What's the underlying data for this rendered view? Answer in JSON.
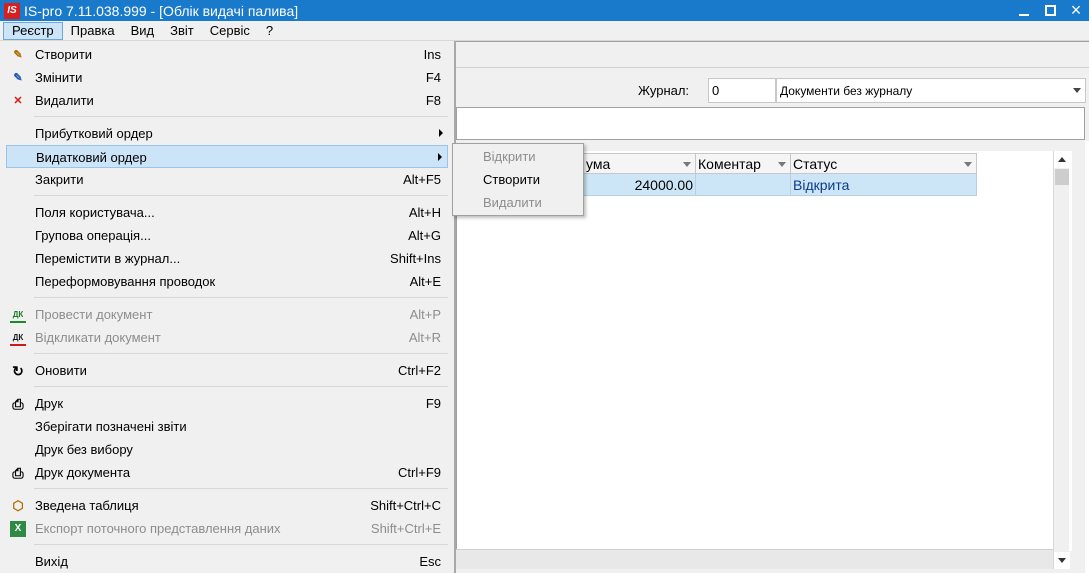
{
  "window": {
    "logo": "IS",
    "title": "IS-pro 7.11.038.999 - [Облік видачі палива]",
    "minimize": "_",
    "close": "×"
  },
  "menubar": [
    "Реєстр",
    "Правка",
    "Вид",
    "Звіт",
    "Сервіс",
    "?"
  ],
  "journal": {
    "label": "Журнал:",
    "number": "0",
    "selected": "Документи без журналу"
  },
  "grid": {
    "headers": [
      "ума",
      "Коментар",
      "Статус"
    ],
    "rows": [
      {
        "sum": "24000.00",
        "comment": "",
        "status": "Відкрита"
      }
    ]
  },
  "dropdown": {
    "items": [
      {
        "label": "Створити",
        "shortcut": "Ins",
        "icon": "new-doc-icon",
        "glyph": "✎"
      },
      {
        "label": "Змінити",
        "shortcut": "F4",
        "icon": "edit-doc-icon",
        "glyph": "✎"
      },
      {
        "label": "Видалити",
        "shortcut": "F8",
        "icon": "delete-doc-icon",
        "glyph": "✕"
      },
      {
        "label": "Прибутковий ордер",
        "shortcut": "",
        "icon": "",
        "glyph": ""
      },
      {
        "label": "Видатковий ордер",
        "shortcut": "",
        "icon": "",
        "glyph": ""
      },
      {
        "label": "Закрити",
        "shortcut": "Alt+F5",
        "icon": "",
        "glyph": ""
      },
      {
        "label": "Поля користувача...",
        "shortcut": "Alt+H",
        "icon": "",
        "glyph": ""
      },
      {
        "label": "Групова операція...",
        "shortcut": "Alt+G",
        "icon": "",
        "glyph": ""
      },
      {
        "label": "Перемістити в журнал...",
        "shortcut": "Shift+Ins",
        "icon": "",
        "glyph": ""
      },
      {
        "label": "Переформовування проводок",
        "shortcut": "Alt+E",
        "icon": "",
        "glyph": ""
      },
      {
        "label": "Провести документ",
        "shortcut": "Alt+P",
        "icon": "post-document-icon",
        "glyph": "ДК"
      },
      {
        "label": "Відкликати документ",
        "shortcut": "Alt+R",
        "icon": "recall-document-icon",
        "glyph": "ДК"
      },
      {
        "label": "Оновити",
        "shortcut": "Ctrl+F2",
        "icon": "refresh-icon",
        "glyph": "↻"
      },
      {
        "label": "Друк",
        "shortcut": "F9",
        "icon": "printer-icon",
        "glyph": "⎙"
      },
      {
        "label": "Зберігати позначені звіти",
        "shortcut": "",
        "icon": "",
        "glyph": ""
      },
      {
        "label": "Друк без вибору",
        "shortcut": "",
        "icon": "",
        "glyph": ""
      },
      {
        "label": "Друк документа",
        "shortcut": "Ctrl+F9",
        "icon": "print-document-icon",
        "glyph": "⎙"
      },
      {
        "label": "Зведена таблиця",
        "shortcut": "Shift+Ctrl+C",
        "icon": "pivot-table-icon",
        "glyph": "⬡"
      },
      {
        "label": "Експорт поточного представлення даних",
        "shortcut": "Shift+Ctrl+E",
        "icon": "excel-export-icon",
        "glyph": "X"
      },
      {
        "label": "Вихід",
        "shortcut": "Esc",
        "icon": "",
        "glyph": ""
      }
    ]
  },
  "submenu": {
    "items": [
      {
        "label": "Відкрити"
      },
      {
        "label": "Створити"
      },
      {
        "label": "Видалити"
      }
    ]
  },
  "colors": {
    "titlebar": "#1979ca",
    "highlight": "#cce4f7",
    "grid_row": "#cde6f7",
    "status_text": "#0b3a8c"
  }
}
